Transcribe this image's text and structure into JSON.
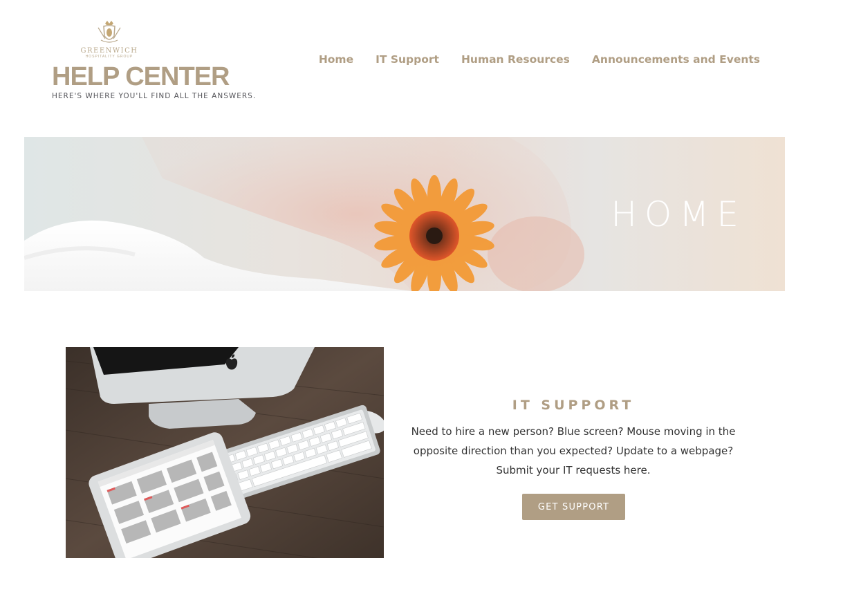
{
  "logo": {
    "wordmark": "GREENWICH",
    "subline": "HOSPITALITY GROUP"
  },
  "site": {
    "title": "HELP CENTER",
    "tagline": "HERE'S WHERE YOU'LL FIND ALL THE ANSWERS."
  },
  "nav": {
    "items": [
      {
        "label": "Home"
      },
      {
        "label": "IT Support"
      },
      {
        "label": "Human Resources"
      },
      {
        "label": "Announcements and Events"
      }
    ]
  },
  "hero": {
    "title": "HOME"
  },
  "it_support": {
    "title": "IT SUPPORT",
    "description_lines": [
      "Need to hire a new person? Blue screen? Mouse moving in the",
      "opposite direction than you expected? Update to a webpage?",
      "Submit your IT requests here."
    ],
    "button_label": "GET SUPPORT"
  },
  "colors": {
    "brand": "#b09e84",
    "text": "#333333",
    "tagline": "#55555a",
    "hero_title": "#ffffff",
    "flower": "#f28a2a"
  },
  "icons": {
    "logo_crest": "crest-icon",
    "apple_logo": "apple-logo-icon"
  }
}
